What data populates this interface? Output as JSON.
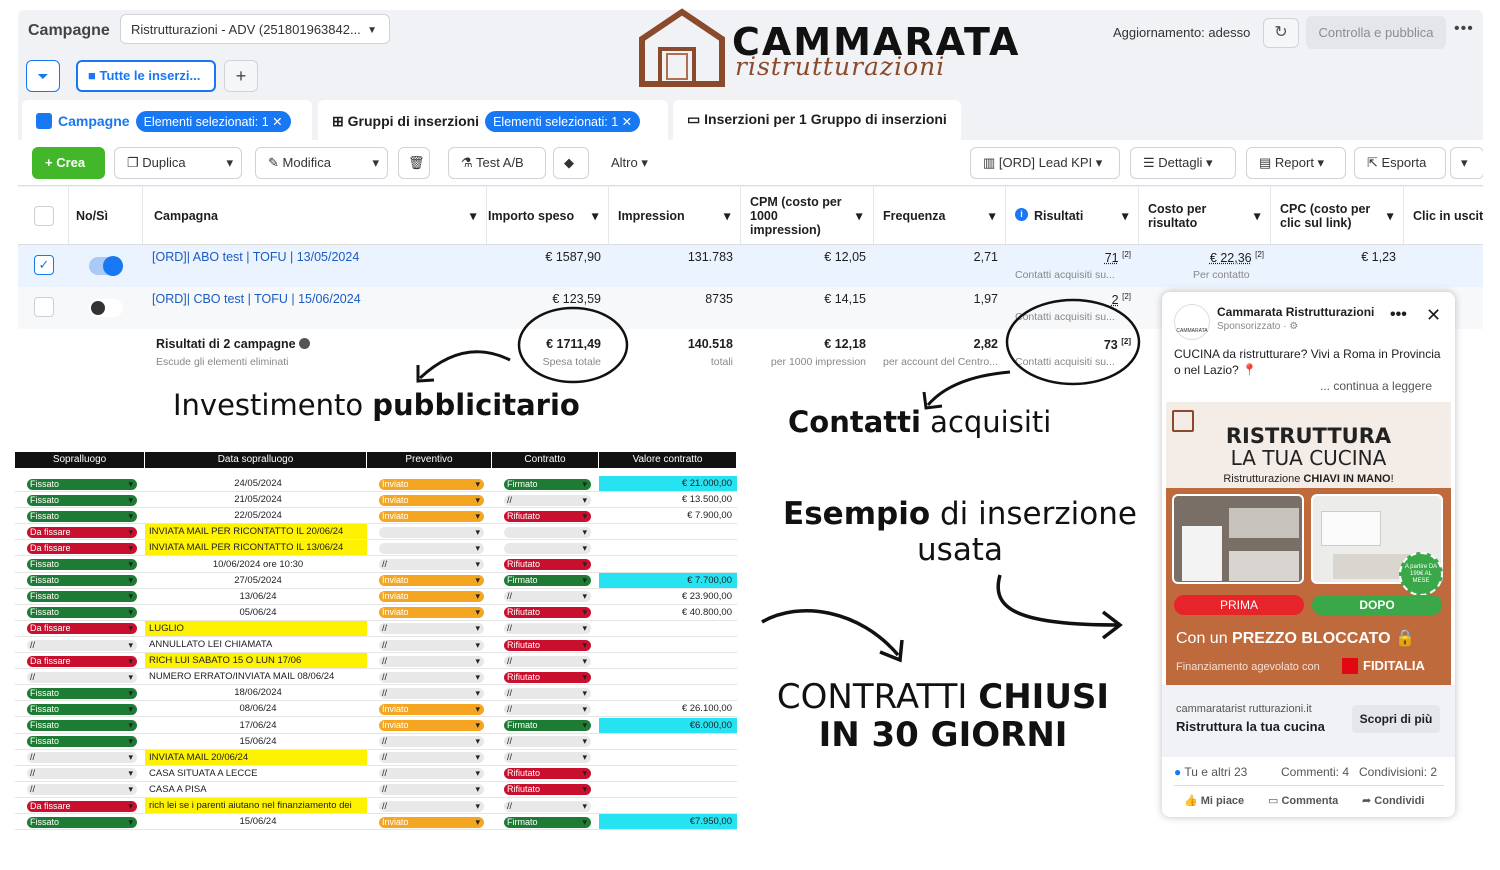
{
  "topbar": {
    "title": "Campagne",
    "account": "Ristrutturazioni - ADV (251801963842...",
    "updated": "Aggiornamento: adesso",
    "publish": "Controlla e pubblica"
  },
  "filters": {
    "all_ads": "Tutte le inserzi..."
  },
  "tabs": [
    {
      "label": "Campagne",
      "pill": "Elementi selezionati: 1"
    },
    {
      "label": "Gruppi di inserzioni",
      "pill": "Elementi selezionati: 1"
    },
    {
      "label": "Inserzioni per 1 Gruppo di inserzioni"
    }
  ],
  "toolbar": {
    "create": "Crea",
    "duplicate": "Duplica",
    "edit": "Modifica",
    "abtest": "Test A/B",
    "more": "Altro",
    "columns": "[ORD] Lead KPI",
    "breakdown": "Dettagli",
    "report": "Report",
    "export": "Esporta"
  },
  "columns": {
    "onoff": "No/Sì",
    "campaign": "Campagna",
    "spent": "Importo speso",
    "impressions": "Impression",
    "cpm": "CPM (costo per 1000 impression)",
    "frequency": "Frequenza",
    "results": "Risultati",
    "cpr": "Costo per risultato",
    "cpc": "CPC (costo per clic sul link)",
    "clicks": "Clic in uscita"
  },
  "rows": [
    {
      "campaign": "[ORD]| ABO test | TOFU | 13/05/2024",
      "spent": "€ 1587,90",
      "impressions": "131.783",
      "cpm": "€ 12,05",
      "frequency": "2,71",
      "results": "71",
      "results_sup": "[2]",
      "results_sub": "Contatti acquisiti su...",
      "cpr": "€ 22,36",
      "cpr_sup": "[2]",
      "cpr_sub": "Per contatto",
      "cpc": "€ 1,23"
    },
    {
      "campaign": "[ORD]| CBO test | TOFU | 15/06/2024",
      "spent": "€ 123,59",
      "impressions": "8735",
      "cpm": "€ 14,15",
      "frequency": "1,97",
      "results": "2",
      "results_sup": "[2]",
      "results_sub": "Contatti acquisiti su..."
    }
  ],
  "totals": {
    "title": "Risultati di 2 campagne",
    "sub": "Escude gli elementi eliminati",
    "spent": "€ 1711,49",
    "spent_sub": "Spesa totale",
    "impressions": "140.518",
    "impressions_sub": "totali",
    "cpm": "€ 12,18",
    "cpm_sub": "per 1000 impression",
    "frequency": "2,82",
    "frequency_sub": "per account del Centro...",
    "results": "73",
    "results_sup": "[2]",
    "results_sub": "Contatti acquisiti su..."
  },
  "logo": {
    "name": "CAMMARATA",
    "script": "ristrutturazioni"
  },
  "annotations": {
    "invest_a": "Investimento ",
    "invest_b": "pubblicitario",
    "contacts_a": "Contatti",
    "contacts_b": " acquisiti",
    "example_a": "Esempio",
    "example_b": " di inserzione",
    "example_c": "usata",
    "closed_a": "CONTRATTI ",
    "closed_b": "CHIUSI",
    "closed_c": "IN 30 GIORNI"
  },
  "sheet": {
    "headers": [
      "Sopralluogo",
      "Data sopralluogo",
      "Preventivo",
      "Contratto",
      "Valore contratto"
    ],
    "rows": [
      [
        "Fissato",
        "24/05/2024",
        "Inviato",
        "Firmato",
        "€ 21.000,00"
      ],
      [
        "Fissato",
        "21/05/2024",
        "Inviato",
        "//",
        "€ 13.500,00"
      ],
      [
        "Fissato",
        "22/05/2024",
        "Inviato",
        "Rifiutato",
        "€ 7.900,00"
      ],
      [
        "Da fissare",
        "INVIATA MAIL PER RICONTATTO IL 20/06/24",
        "",
        "",
        ""
      ],
      [
        "Da fissare",
        "INVIATA MAIL PER RICONTATTO IL 13/06/24",
        "",
        "",
        ""
      ],
      [
        "Fissato",
        "10/06/2024 ore 10:30",
        "//",
        "Rifiutato",
        ""
      ],
      [
        "Fissato",
        "27/05/2024",
        "Inviato",
        "Firmato",
        "€ 7.700,00"
      ],
      [
        "Fissato",
        "13/06/24",
        "Inviato",
        "//",
        "€ 23.900,00"
      ],
      [
        "Fissato",
        "05/06/24",
        "Inviato",
        "Rifiutato",
        "€ 40.800,00"
      ],
      [
        "Da fissare",
        "LUGLIO",
        "//",
        "//",
        ""
      ],
      [
        "//",
        "ANNULLATO LEI CHIAMATA",
        "//",
        "Rifiutato",
        ""
      ],
      [
        "Da fissare",
        "RICH LUI SABATO 15 O LUN 17/06",
        "//",
        "//",
        ""
      ],
      [
        "//",
        "NUMERO ERRATO/INVIATA MAIL 08/06/24",
        "//",
        "Rifiutato",
        ""
      ],
      [
        "Fissato",
        "18/06/2024",
        "//",
        "//",
        ""
      ],
      [
        "Fissato",
        "08/06/24",
        "Inviato",
        "//",
        "€ 26.100,00"
      ],
      [
        "Fissato",
        "17/06/24",
        "Inviato",
        "Firmato",
        "€6.000,00"
      ],
      [
        "Fissato",
        "15/06/24",
        "//",
        "//",
        ""
      ],
      [
        "//",
        "INVIATA MAIL 20/06/24",
        "//",
        "//",
        ""
      ],
      [
        "//",
        "CASA SITUATA A LECCE",
        "//",
        "Rifiutato",
        ""
      ],
      [
        "//",
        "CASA A PISA",
        "//",
        "Rifiutato",
        ""
      ],
      [
        "Da fissare",
        "rich lei se i parenti aiutano nel finanziamento dei",
        "//",
        "//",
        ""
      ],
      [
        "Fissato",
        "15/06/24",
        "Inviato",
        "Firmato",
        "€7.950,00"
      ]
    ]
  },
  "ad": {
    "page": "Cammarata Ristrutturazioni",
    "sponsored": "Sponsorizzato · ⚙",
    "text": "CUCINA da ristrutturare? Vivi a Roma in Provincia o nel Lazio? 📍",
    "more": "... continua a leggere",
    "logo_small": "CAMMARATA",
    "headline1": "RISTRUTTURA",
    "headline2": "LA TUA CUCINA",
    "tag_a": "Ristrutturazione ",
    "tag_b": "CHIAVI IN MANO",
    "tag_c": "!",
    "badge": "A partire DA 199€ AL MESE",
    "before": "PRIMA",
    "after": "DOPO",
    "blocked_a": "Con un ",
    "blocked_b": "PREZZO BLOCCATO",
    "finance": "Finanziamento agevolato con",
    "fiditalia": "FIDITALIA",
    "domain": "cammaratarist rutturazioni.it",
    "cta_title": "Ristruttura la tua cucina",
    "cta": "Scopri di più",
    "reactions": "Tu e altri 23",
    "comments": "Commenti: 4",
    "shares": "Condivisioni: 2",
    "like": "Mi piace",
    "comment": "Commenta",
    "share": "Condividi"
  },
  "colors": {
    "fb_blue": "#1877f2",
    "green": "#1e7b34",
    "red": "#c8102e",
    "yellow": "#fff200",
    "cyan": "#27e3f2",
    "orange": "#f4a623",
    "brand_brown": "#8b4a2b"
  }
}
